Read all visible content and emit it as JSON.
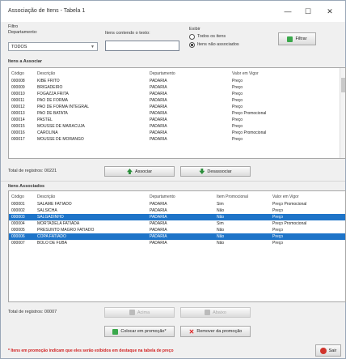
{
  "window": {
    "title": "Associação de Itens - Tabela 1",
    "minimize": "—",
    "maximize": "☐",
    "close": "✕"
  },
  "filter": {
    "group_label": "Filtro",
    "department_label": "Departamento:",
    "department_value": "TODOS",
    "item_text_label": "Itens contendo o texto:",
    "item_text_value": "",
    "show_label": "Exibir",
    "options": [
      "Todos os itens",
      "Itens não associados"
    ],
    "selected_option": 1,
    "filter_button": "Filtrar"
  },
  "to_associate": {
    "section_title": "Itens a Associar",
    "columns": [
      "Código",
      "Descrição",
      "Departamento",
      "Valor em Vigor"
    ],
    "rows": [
      [
        "000008",
        "KIBE FRITO",
        "PADARIA",
        "Preço"
      ],
      [
        "000009",
        "BRIGADEIRO",
        "PADARIA",
        "Preço"
      ],
      [
        "000010",
        "FOGAZZA FRITA",
        "PADARIA",
        "Preço"
      ],
      [
        "000011",
        "PAO DE FORMA",
        "PADARIA",
        "Preço"
      ],
      [
        "000012",
        "PAO DE FORMA INTEGRAL",
        "PADARIA",
        "Preço"
      ],
      [
        "000013",
        "PAO DE BATATA",
        "PADARIA",
        "Preço Promocional"
      ],
      [
        "000014",
        "PASTEL",
        "PADARIA",
        "Preço"
      ],
      [
        "000015",
        "MOUSSE DE MARACUJA",
        "PADARIA",
        "Preço"
      ],
      [
        "000016",
        "CAROLINA",
        "PADARIA",
        "Preço Promocional"
      ],
      [
        "000017",
        "MOUSSE DE MORANGO",
        "PADARIA",
        "Preço"
      ]
    ],
    "total_label": "Total de registros: 00221",
    "associate_button": "Associar",
    "disassociate_button": "Desassociar"
  },
  "associated": {
    "section_title": "Itens Associados",
    "columns": [
      "Código",
      "Descrição",
      "Departamento",
      "Item Promocional",
      "Valor em Vigor"
    ],
    "rows": [
      [
        "000001",
        "SALAME FATIADO",
        "PADARIA",
        "Sim",
        "Preço Promocional"
      ],
      [
        "000002",
        "SALSICHA",
        "PADARIA",
        "Não",
        "Preço"
      ],
      [
        "000003",
        "SALGADINHO",
        "PADARIA",
        "Não",
        "Preço"
      ],
      [
        "000004",
        "MORTADELA FATIADA",
        "PADARIA",
        "Sim",
        "Preço Promocional"
      ],
      [
        "000005",
        "PRESUNTO MAGRO FATIADO",
        "PADARIA",
        "Não",
        "Preço"
      ],
      [
        "000006",
        "COPA FATIADO",
        "PADARIA",
        "Não",
        "Preço"
      ],
      [
        "000007",
        "BOLO DE FUBA",
        "PADARIA",
        "Não",
        "Preço"
      ]
    ],
    "selected_rows": [
      2,
      5
    ],
    "total_label": "Total de registros: 00007",
    "up_button": "Acima",
    "down_button": "Abaixo",
    "put_promo_button": "Colocar em promoção*",
    "remove_promo_button": "Remover da promoção"
  },
  "footnote": "* Itens em promoção indicam que eles serão exibidos em destaque na tabela de preço",
  "exit_button": "Sair"
}
